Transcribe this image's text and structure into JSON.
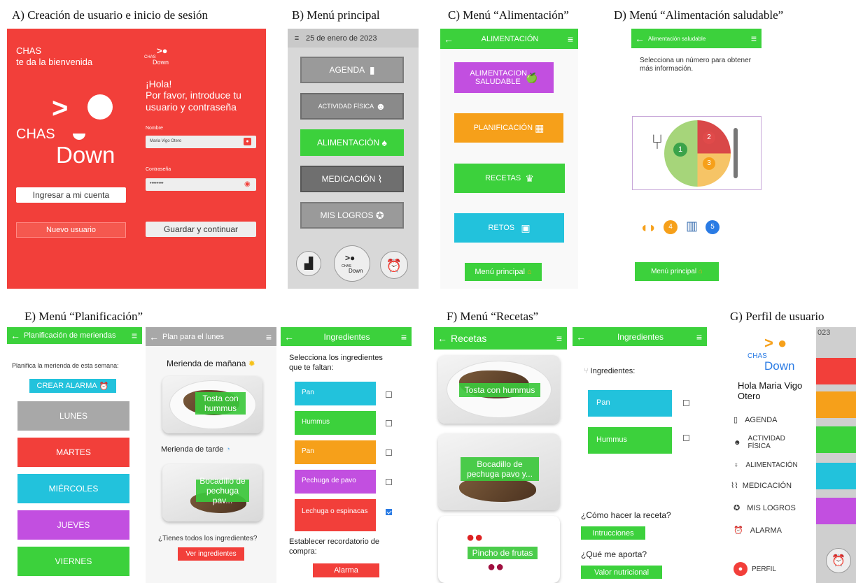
{
  "captions": {
    "a": "A) Creación de usuario e inicio de sesión",
    "b": "B) Menú principal",
    "c": "C) Menú “Alimentación”",
    "d": "D) Menú “Alimentación saludable”",
    "e": "E) Menú “Planificación”",
    "f": "F) Menú “Recetas”",
    "g": "G) Perfil de usuario"
  },
  "colors": {
    "red": "#f23f3a",
    "green": "#3cd13c",
    "gray": "#9a9a9a",
    "cyan": "#22c2dc",
    "purple": "#c24fe0",
    "orange": "#f6a01a"
  },
  "a": {
    "welcome_1": "CHAS",
    "welcome_2": "te da la bienvenida",
    "logo_chas": "CHAS",
    "logo_down": "Down",
    "mini_chas": "CHAS",
    "mini_down": "Down",
    "hola": "¡Hola!",
    "prompt": "Por favor, introduce tu usuario y contraseña",
    "nombre_label": "Nombre",
    "nombre_value": "Maria Vigo Otero",
    "pass_label": "Contraseña",
    "pass_value": "••••••••",
    "login_button": "Ingresar a mi cuenta",
    "new_user_button": "Nuevo usuario",
    "save_button": "Guardar y continuar"
  },
  "b": {
    "date": "25 de enero de 2023",
    "menu": [
      "AGENDA",
      "ACTIVIDAD FÍSICA",
      "ALIMENTACIÓN",
      "MEDICACIÓN",
      "MIS LOGROS"
    ],
    "logo_chas": "CHAS",
    "logo_down": "Down"
  },
  "c": {
    "title": "ALIMENTACIÓN",
    "menu": [
      "ALIMENTACION SALUDABLE",
      "PLANIFICACIÓN",
      "RECETAS",
      "RETOS"
    ],
    "main_button": "Menú principal"
  },
  "d": {
    "title": "Alimentación saludable",
    "instruction": "Selecciona un número para obtener más información.",
    "plate_numbers": [
      "1",
      "2",
      "3"
    ],
    "extra_numbers": [
      "4",
      "5"
    ],
    "main_button": "Menú principal"
  },
  "e": {
    "p1_title": "Planificación de meriendas",
    "p1_subtitle": "Planifica la merienda de esta semana:",
    "alarm_button": "CREAR ALARMA",
    "days": [
      "LUNES",
      "MARTES",
      "MIÉRCOLES",
      "JUEVES",
      "VIERNES"
    ],
    "p2_title": "Plan para el lunes",
    "morning": "Merienda de mañana",
    "morning_food": "Tosta con hummus",
    "afternoon": "Merienda de tarde",
    "afternoon_food": "Bocadillo de pechuga pav...",
    "question": "¿Tienes todos los ingredientes?",
    "see_button": "Ver ingredientes",
    "p3_title": "Ingredientes",
    "p3_prompt": "Selecciona los ingredientes que te faltan:",
    "ingredients": [
      "Pan",
      "Hummus",
      "Pan",
      "Pechuga de pavo",
      "Lechuga o espinacas"
    ],
    "reminder": "Establecer recordatorio de compra:",
    "alarm": "Alarma"
  },
  "f": {
    "p1_title": "Recetas",
    "recipes": [
      "Tosta con hummus",
      "Bocadillo de pechuga pavo y...",
      "Pincho de frutas"
    ],
    "p2_title": "Ingredientes",
    "ing_label": "Ingredientes:",
    "ingredients": [
      "Pan",
      "Hummus"
    ],
    "how": "¿Cómo hacer la receta?",
    "instructions_button": "Intrucciones",
    "what": "¿Qué me aporta?",
    "nutrition_button": "Valor nutricional"
  },
  "g": {
    "logo_chas": "CHAS",
    "logo_down": "Down",
    "greeting": "Hola Maria Vigo Otero",
    "menu": [
      "AGENDA",
      "ACTIVIDAD FÍSICA",
      "ALIMENTACIÓN",
      "MEDICACIÓN",
      "MIS LOGROS",
      "ALARMA"
    ],
    "profile": "PERFIL",
    "year_fragment": "023"
  }
}
